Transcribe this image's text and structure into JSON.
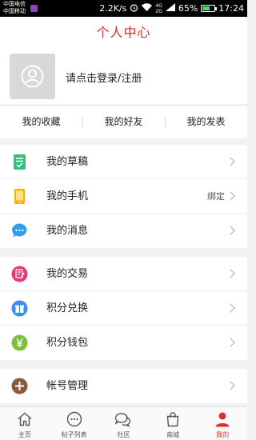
{
  "status_bar": {
    "carrier_1": "中国电信",
    "carrier_2": "中国移动",
    "speed": "2.2K/s",
    "network_4g": "4G",
    "network_2g": "2G",
    "battery": "65%",
    "battery_level": 0.65,
    "time": "17:24"
  },
  "header": {
    "title": "个人中心"
  },
  "profile": {
    "login_prompt": "请点击登录/注册"
  },
  "quick_tabs": [
    {
      "label": "我的收藏"
    },
    {
      "label": "我的好友"
    },
    {
      "label": "我的发表"
    }
  ],
  "groups": [
    {
      "items": [
        {
          "label": "我的草稿",
          "value": "",
          "icon": "draft-icon",
          "color": "#2ec27e"
        },
        {
          "label": "我的手机",
          "value": "绑定",
          "icon": "phone-icon",
          "color": "#f5b400"
        },
        {
          "label": "我的消息",
          "value": "",
          "icon": "message-icon",
          "color": "#2d9ff0"
        }
      ]
    },
    {
      "items": [
        {
          "label": "我的交易",
          "value": "",
          "icon": "trade-icon",
          "color": "#e8367a"
        },
        {
          "label": "积分兑换",
          "value": "",
          "icon": "gift-icon",
          "color": "#3d8cf0"
        },
        {
          "label": "积分钱包",
          "value": "",
          "icon": "wallet-icon",
          "color": "#7cc23f"
        }
      ]
    },
    {
      "items": [
        {
          "label": "帐号管理",
          "value": "",
          "icon": "account-add-icon",
          "color": "#8b5a3c"
        }
      ]
    }
  ],
  "bottom_nav": [
    {
      "label": "主页",
      "icon": "home-icon"
    },
    {
      "label": "帖子列表",
      "icon": "post-list-icon"
    },
    {
      "label": "社区",
      "icon": "community-icon"
    },
    {
      "label": "商城",
      "icon": "shop-icon"
    },
    {
      "label": "我的",
      "icon": "profile-icon",
      "active": true
    }
  ],
  "colors": {
    "accent": "#d7312e",
    "background": "#f2f2f2"
  }
}
